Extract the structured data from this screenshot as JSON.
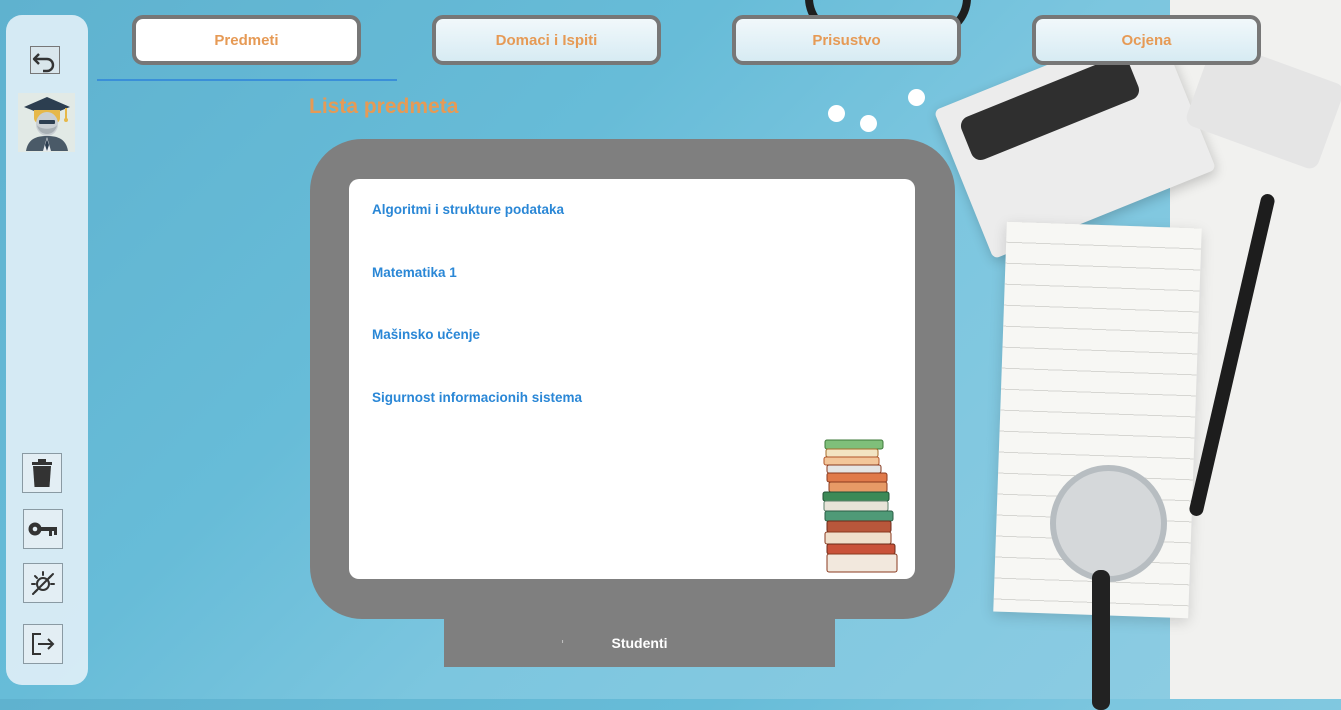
{
  "tabs": [
    {
      "label": "Predmeti",
      "active": true
    },
    {
      "label": "Domaci i Ispiti",
      "active": false
    },
    {
      "label": "Prisustvo",
      "active": false
    },
    {
      "label": "Ocjena",
      "active": false
    }
  ],
  "section_title": "Lista predmeta",
  "subjects": [
    "Algoritmi i strukture podataka",
    "Matematika 1",
    "Mašinsko učenje",
    "Sigurnost informacionih sistema"
  ],
  "bottom_tab": {
    "label": "Studenti",
    "marker": "ı"
  },
  "sidebar": {
    "icons": [
      "undo-icon",
      "user-avatar",
      "trash-icon",
      "key-icon",
      "no-theme-icon",
      "logout-icon"
    ]
  },
  "colors": {
    "accent": "#e69a55",
    "link": "#2a87d6",
    "frame": "#7f7f7f",
    "tab_border": "#777777",
    "underline": "#3a8fd8"
  }
}
